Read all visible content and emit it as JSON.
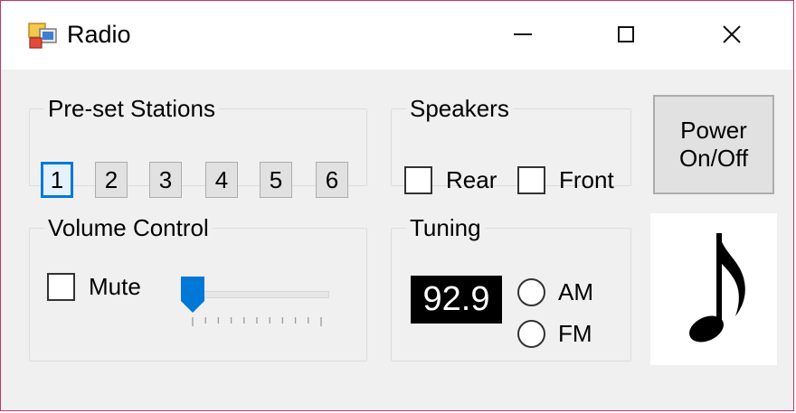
{
  "window": {
    "title": "Radio"
  },
  "icons": {
    "app": "radio-app-icon",
    "minimize": "minimize-icon",
    "maximize": "maximize-icon",
    "close": "close-icon",
    "music_note": "music-note-icon"
  },
  "colors": {
    "accent": "#0078d7",
    "display_bg": "#000000",
    "display_fg": "#ffffff"
  },
  "preset_stations": {
    "legend": "Pre-set Stations",
    "buttons": [
      "1",
      "2",
      "3",
      "4",
      "5",
      "6"
    ],
    "selected": "1"
  },
  "speakers": {
    "legend": "Speakers",
    "rear": {
      "label": "Rear",
      "checked": false
    },
    "front": {
      "label": "Front",
      "checked": false
    }
  },
  "power": {
    "line1": "Power",
    "line2": "On/Off"
  },
  "volume": {
    "legend": "Volume Control",
    "mute": {
      "label": "Mute",
      "checked": false
    },
    "level": 0,
    "tick_count": 11
  },
  "tuning": {
    "legend": "Tuning",
    "frequency": "92.9",
    "am": {
      "label": "AM",
      "selected": false
    },
    "fm": {
      "label": "FM",
      "selected": false
    }
  }
}
